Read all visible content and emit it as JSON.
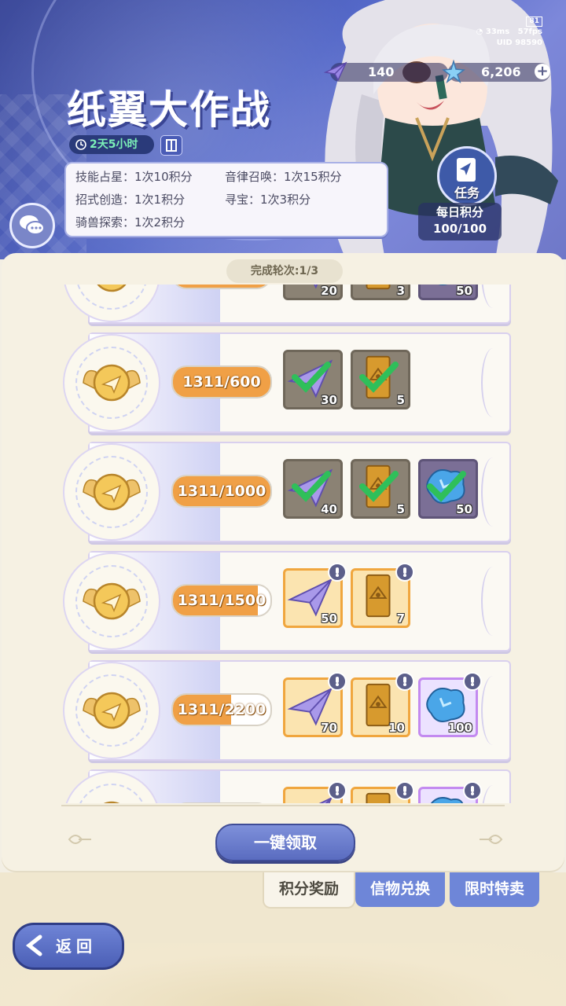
{
  "status": {
    "battery": "81",
    "ping": "33ms",
    "fps": "57fps",
    "uid": "UID 98590"
  },
  "resources": {
    "airplanes": "140",
    "stars": "6,206"
  },
  "event": {
    "title": "纸翼大作战",
    "timer": "2天5小时"
  },
  "rules": [
    "技能占星：1次10积分",
    "音律召唤：1次15积分",
    "招式创造：1次1积分",
    "寻宝：1次3积分",
    "骑兽探索：1次2积分"
  ],
  "task": {
    "label": "任务",
    "daily_label": "每日积分",
    "daily_value": "100/100"
  },
  "panel": {
    "round": "完成轮次:1/3",
    "claim_all": "一键领取"
  },
  "tiers": [
    {
      "progress": "",
      "fill": 1.0,
      "rewards": [
        {
          "type": "plane",
          "count": "20",
          "state": "claimed"
        },
        {
          "type": "card",
          "count": "3",
          "state": "claimed"
        },
        {
          "type": "gem",
          "count": "50",
          "state": "claimed"
        }
      ]
    },
    {
      "progress": "1311/600",
      "fill": 1.0,
      "rewards": [
        {
          "type": "plane",
          "count": "30",
          "state": "claimed"
        },
        {
          "type": "card",
          "count": "5",
          "state": "claimed"
        }
      ]
    },
    {
      "progress": "1311/1000",
      "fill": 1.0,
      "rewards": [
        {
          "type": "plane",
          "count": "40",
          "state": "claimed"
        },
        {
          "type": "card",
          "count": "5",
          "state": "claimed"
        },
        {
          "type": "gem",
          "count": "50",
          "state": "claimed"
        }
      ]
    },
    {
      "progress": "1311/1500",
      "fill": 0.874,
      "rewards": [
        {
          "type": "plane",
          "count": "50",
          "state": "open"
        },
        {
          "type": "card",
          "count": "7",
          "state": "open"
        }
      ]
    },
    {
      "progress": "1311/2200",
      "fill": 0.596,
      "rewards": [
        {
          "type": "plane",
          "count": "70",
          "state": "open"
        },
        {
          "type": "card",
          "count": "10",
          "state": "open"
        },
        {
          "type": "gem",
          "count": "100",
          "state": "open"
        }
      ]
    },
    {
      "progress": "",
      "fill": 0.3,
      "rewards": [
        {
          "type": "plane",
          "count": "",
          "state": "open"
        },
        {
          "type": "card",
          "count": "",
          "state": "open"
        },
        {
          "type": "gem",
          "count": "",
          "state": "open"
        }
      ]
    }
  ],
  "tabs": {
    "points": "积分奖励",
    "exchange": "信物兑换",
    "sale": "限时特卖"
  },
  "back": "返回",
  "colors": {
    "accent": "#f0a046",
    "tab_blue": "#6e86d8",
    "panel": "#f6f1e3"
  }
}
